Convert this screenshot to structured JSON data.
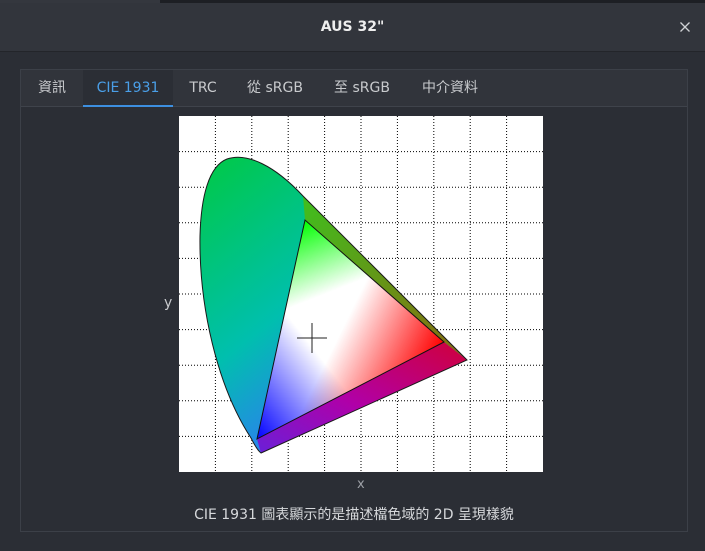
{
  "window": {
    "title": "AUS 32\""
  },
  "tabs": [
    {
      "label": "資訊"
    },
    {
      "label": "CIE 1931"
    },
    {
      "label": "TRC"
    },
    {
      "label": "從 sRGB"
    },
    {
      "label": "至 sRGB"
    },
    {
      "label": "中介資料"
    }
  ],
  "active_tab": "CIE 1931",
  "plot": {
    "xlabel": "x",
    "ylabel": "y",
    "caption": "CIE 1931 圖表顯示的是描述檔色域的 2D 呈現樣貌"
  },
  "icons": {
    "close": "close-icon",
    "crosshair": "white-point-crosshair-icon"
  },
  "colors": {
    "accent": "#3d8fe0",
    "background": "#2b2e35",
    "titlebar": "#32353c"
  }
}
